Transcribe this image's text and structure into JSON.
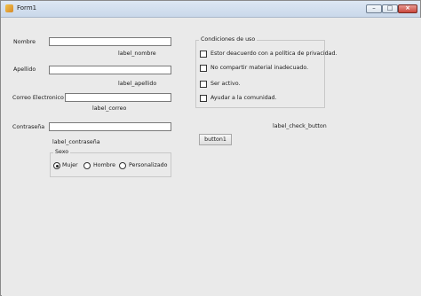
{
  "window": {
    "title": "Form1"
  },
  "form": {
    "nombre": {
      "label": "Nombre",
      "value": "",
      "status": "label_nombre"
    },
    "apellido": {
      "label": "Apellido",
      "value": "",
      "status": "label_apellido"
    },
    "correo": {
      "label": "Correo Electronico",
      "value": "",
      "status": "label_correo"
    },
    "contrasena": {
      "label": "Contraseña",
      "value": "",
      "status": "label_contraseña"
    }
  },
  "sexo": {
    "title": "Sexo",
    "options": [
      "Mujer",
      "Hombre",
      "Personalizado"
    ],
    "selected": "Mujer"
  },
  "condiciones": {
    "title": "Condiciones de uso",
    "items": [
      "Estor deacuerdo con a política de privacidad.",
      "No compartir material inadecuado.",
      "Ser activo.",
      "Ayudar a la comunidad."
    ]
  },
  "check_status": "label_check_button",
  "button1_label": "button1"
}
